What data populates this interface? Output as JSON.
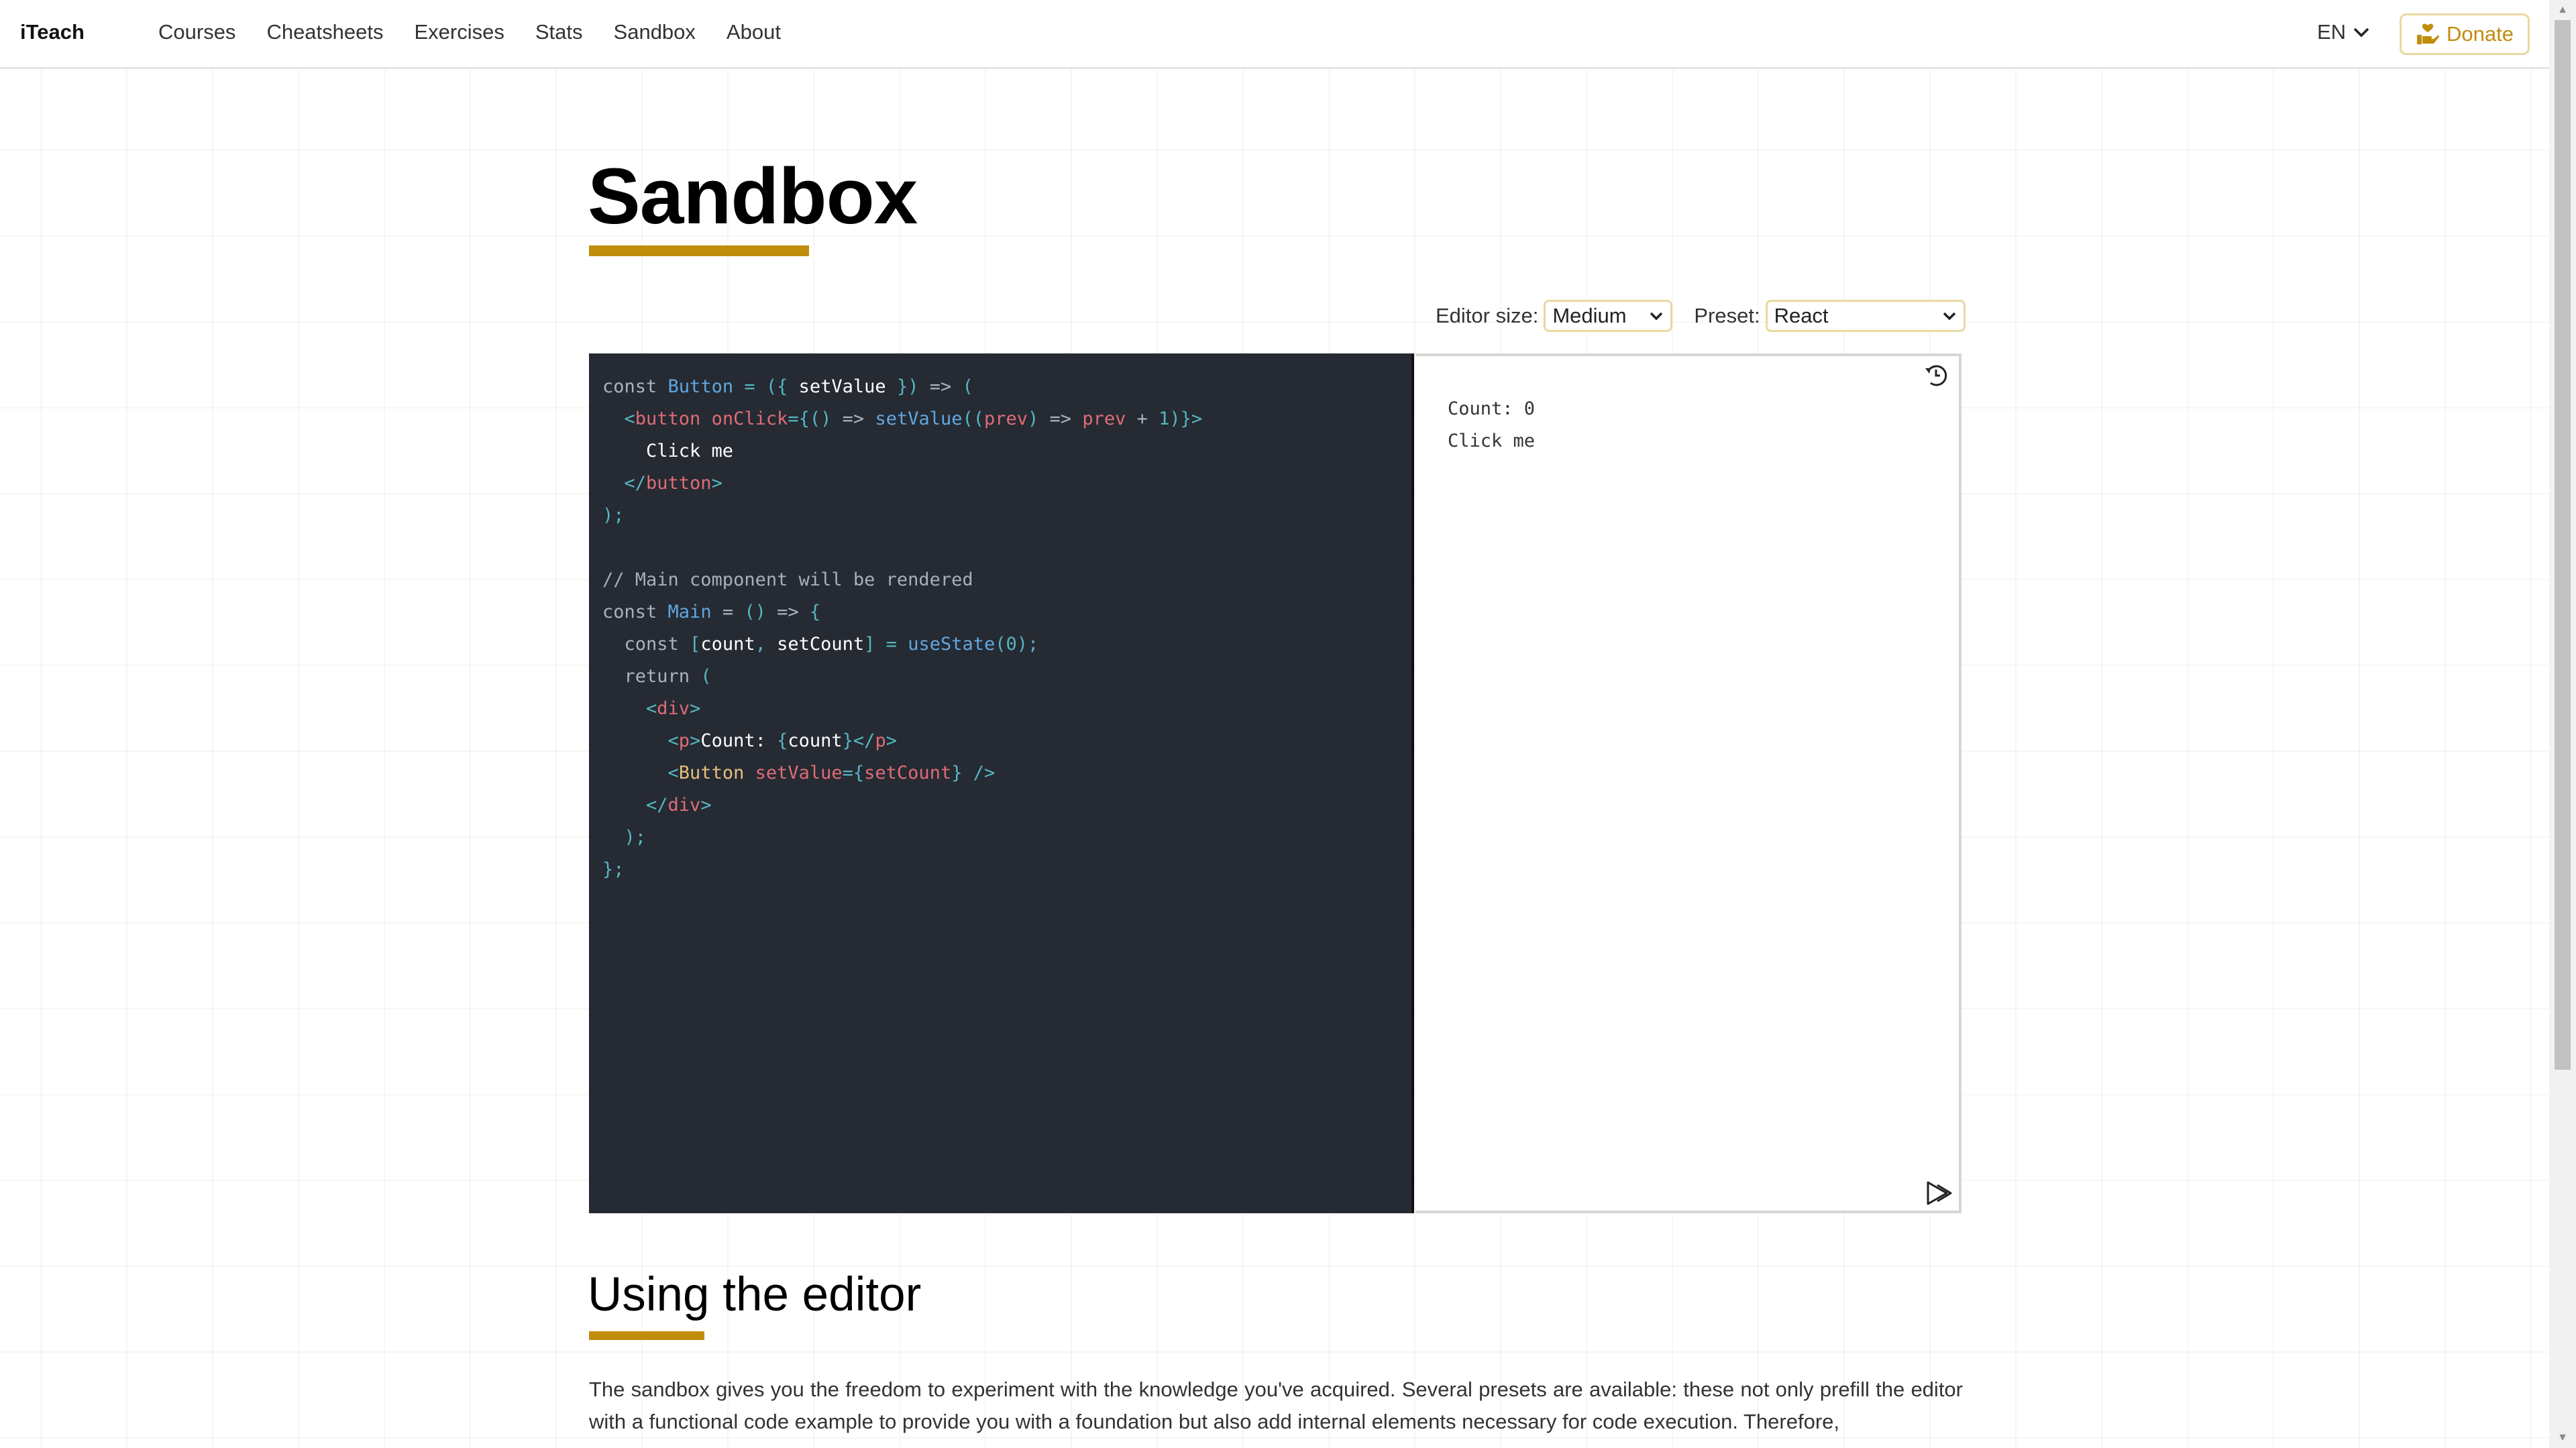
{
  "nav": {
    "brand": "iTeach",
    "links": [
      "Courses",
      "Cheatsheets",
      "Exercises",
      "Stats",
      "Sandbox",
      "About"
    ],
    "language": "EN",
    "donate_label": "Donate",
    "accent_color": "#c08d0c"
  },
  "page": {
    "title": "Sandbox"
  },
  "controls": {
    "editor_size_label": "Editor size:",
    "editor_size_value": "Medium",
    "preset_label": "Preset:",
    "preset_value": "React"
  },
  "editor": {
    "code_lines": [
      [
        [
          "kw",
          "const "
        ],
        [
          "fn",
          "Button"
        ],
        [
          "punc",
          " = ({ "
        ],
        [
          "var",
          "setValue"
        ],
        [
          "punc",
          " }) "
        ],
        [
          "kw",
          "=> "
        ],
        [
          "punc",
          "("
        ]
      ],
      [
        [
          "kw",
          "  "
        ],
        [
          "punc",
          "<"
        ],
        [
          "tag",
          "button "
        ],
        [
          "attr",
          "onClick"
        ],
        [
          "punc",
          "={() "
        ],
        [
          "kw",
          "=> "
        ],
        [
          "fn",
          "setValue"
        ],
        [
          "punc",
          "(("
        ],
        [
          "attr",
          "prev"
        ],
        [
          "punc",
          ") "
        ],
        [
          "kw",
          "=> "
        ],
        [
          "attr",
          "prev"
        ],
        [
          "kw",
          " + "
        ],
        [
          "num",
          "1"
        ],
        [
          "punc",
          ")}>"
        ]
      ],
      [
        [
          "txt",
          "    Click me"
        ]
      ],
      [
        [
          "punc",
          "  </"
        ],
        [
          "tag",
          "button"
        ],
        [
          "punc",
          ">"
        ]
      ],
      [
        [
          "punc",
          ");"
        ]
      ],
      [
        [
          "kw",
          ""
        ]
      ],
      [
        [
          "cmt",
          "// Main component will be rendered"
        ]
      ],
      [
        [
          "kw",
          "const "
        ],
        [
          "fn",
          "Main"
        ],
        [
          "kw",
          " = "
        ],
        [
          "punc",
          "() "
        ],
        [
          "kw",
          "=> "
        ],
        [
          "punc",
          "{"
        ]
      ],
      [
        [
          "kw",
          "  const "
        ],
        [
          "punc",
          "["
        ],
        [
          "var",
          "count"
        ],
        [
          "punc",
          ", "
        ],
        [
          "var",
          "setCount"
        ],
        [
          "punc",
          "] = "
        ],
        [
          "fn",
          "useState"
        ],
        [
          "punc",
          "("
        ],
        [
          "num",
          "0"
        ],
        [
          "punc",
          ");"
        ]
      ],
      [
        [
          "kw",
          "  return "
        ],
        [
          "punc",
          "("
        ]
      ],
      [
        [
          "punc",
          "    <"
        ],
        [
          "tag",
          "div"
        ],
        [
          "punc",
          ">"
        ]
      ],
      [
        [
          "punc",
          "      <"
        ],
        [
          "tag",
          "p"
        ],
        [
          "punc",
          ">"
        ],
        [
          "txt",
          "Count: "
        ],
        [
          "punc",
          "{"
        ],
        [
          "var",
          "count"
        ],
        [
          "punc",
          "}</"
        ],
        [
          "tag",
          "p"
        ],
        [
          "punc",
          ">"
        ]
      ],
      [
        [
          "punc",
          "      <"
        ],
        [
          "comp",
          "Button "
        ],
        [
          "attr",
          "setValue"
        ],
        [
          "punc",
          "={"
        ],
        [
          "attr",
          "setCount"
        ],
        [
          "punc",
          "} />"
        ]
      ],
      [
        [
          "punc",
          "    </"
        ],
        [
          "tag",
          "div"
        ],
        [
          "punc",
          ">"
        ]
      ],
      [
        [
          "punc",
          "  );"
        ]
      ],
      [
        [
          "punc",
          "};"
        ]
      ]
    ]
  },
  "preview": {
    "output_lines": [
      "Count: 0",
      "Click me"
    ],
    "reset_icon": "history-icon",
    "run_icon": "run-icon"
  },
  "section": {
    "title": "Using the editor",
    "paragraph": "The sandbox gives you the freedom to experiment with the knowledge you've acquired. Several presets are available: these not only prefill the editor with a functional code example to provide you with a foundation but also add internal elements necessary for code execution. Therefore,"
  }
}
